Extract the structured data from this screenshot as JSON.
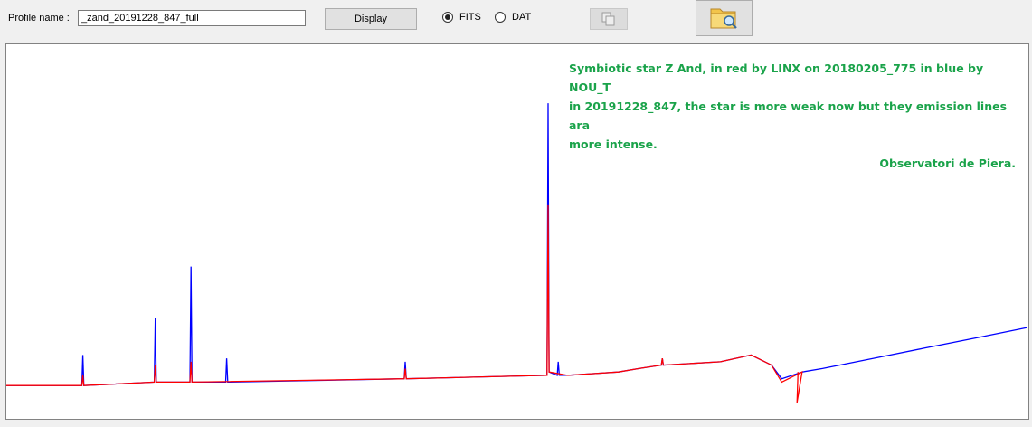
{
  "toolbar": {
    "profile_label": "Profile name :",
    "profile_value": "_zand_20191228_847_full",
    "display_label": "Display",
    "format_options": [
      "FITS",
      "DAT"
    ],
    "format_selected": "FITS",
    "copy_icon": "copy-icon",
    "open_icon": "folder-search-icon"
  },
  "plot": {
    "annotation_lines": [
      "Symbiotic star Z And, in red by LINX on 20180205_775 in blue by NOU_T",
      "in 20191228_847, the star is more weak now but they emission lines ara",
      "more intense."
    ],
    "signature": "Observatori de Piera.",
    "annotation_color": "#1aa34a"
  },
  "chart_data": {
    "type": "line",
    "title": "",
    "xlabel": "",
    "ylabel": "",
    "x_units": "relative position (0-1)",
    "grid": false,
    "legend": "none",
    "series": [
      {
        "color": "#0000ff",
        "x": [
          0.0,
          0.074,
          0.075,
          0.076,
          0.145,
          0.146,
          0.147,
          0.18,
          0.181,
          0.182,
          0.215,
          0.216,
          0.217,
          0.39,
          0.391,
          0.392,
          0.53,
          0.531,
          0.532,
          0.54,
          0.541,
          0.542,
          0.55,
          0.6,
          0.62,
          0.642,
          0.643,
          0.644,
          0.7,
          0.73,
          0.75,
          0.76,
          0.78,
          0.8,
          0.85,
          0.9,
          0.95,
          1.0
        ],
        "y": [
          0.05,
          0.05,
          0.14,
          0.05,
          0.06,
          0.25,
          0.06,
          0.06,
          0.4,
          0.06,
          0.06,
          0.13,
          0.06,
          0.07,
          0.12,
          0.07,
          0.08,
          0.88,
          0.09,
          0.08,
          0.12,
          0.08,
          0.08,
          0.09,
          0.1,
          0.11,
          0.13,
          0.11,
          0.12,
          0.14,
          0.11,
          0.07,
          0.09,
          0.1,
          0.13,
          0.16,
          0.19,
          0.22
        ]
      },
      {
        "color": "#ff0000",
        "x": [
          0.0,
          0.074,
          0.075,
          0.076,
          0.145,
          0.146,
          0.147,
          0.18,
          0.181,
          0.182,
          0.39,
          0.391,
          0.392,
          0.53,
          0.531,
          0.532,
          0.55,
          0.6,
          0.62,
          0.642,
          0.643,
          0.644,
          0.7,
          0.73,
          0.75,
          0.76,
          0.78,
          0.775,
          0.776
        ],
        "y": [
          0.05,
          0.05,
          0.08,
          0.05,
          0.06,
          0.11,
          0.06,
          0.06,
          0.12,
          0.06,
          0.07,
          0.1,
          0.07,
          0.08,
          0.58,
          0.09,
          0.08,
          0.09,
          0.1,
          0.11,
          0.13,
          0.11,
          0.12,
          0.14,
          0.11,
          0.06,
          0.09,
          0.0,
          0.09
        ]
      }
    ]
  }
}
